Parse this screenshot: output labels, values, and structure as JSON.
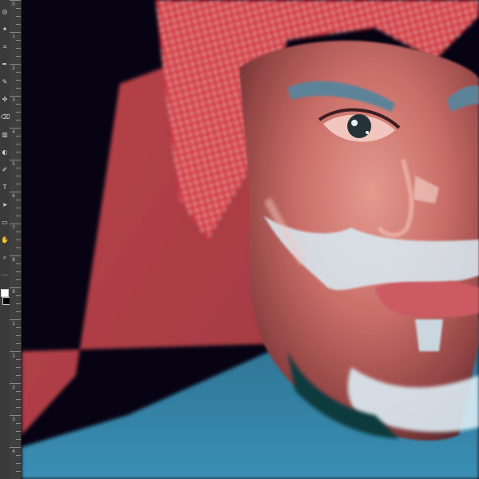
{
  "app": {
    "toolbar_tools": [
      {
        "name": "lasso-tool-icon",
        "glyph": "◎"
      },
      {
        "name": "quick-select-icon",
        "glyph": "✦"
      },
      {
        "name": "crop-tool-icon",
        "glyph": "⌗"
      },
      {
        "name": "eyedropper-icon",
        "glyph": "✒"
      },
      {
        "name": "brush-tool-icon",
        "glyph": "✎"
      },
      {
        "name": "clone-stamp-icon",
        "glyph": "✜"
      },
      {
        "name": "eraser-tool-icon",
        "glyph": "⌫"
      },
      {
        "name": "gradient-tool-icon",
        "glyph": "▥"
      },
      {
        "name": "dodge-tool-icon",
        "glyph": "◐"
      },
      {
        "name": "pen-tool-icon",
        "glyph": "✐"
      },
      {
        "name": "type-tool-icon",
        "glyph": "T"
      },
      {
        "name": "path-selection-icon",
        "glyph": "➤"
      },
      {
        "name": "rectangle-tool-icon",
        "glyph": "▭"
      },
      {
        "name": "hand-tool-icon",
        "glyph": "✋"
      },
      {
        "name": "zoom-tool-icon",
        "glyph": "⌕"
      },
      {
        "name": "edit-toolbar-icon",
        "glyph": "⋯"
      }
    ],
    "ruler_labels": [
      "0",
      "1",
      "2",
      "3",
      "4",
      "5",
      "6",
      "7",
      "8",
      "9",
      "1",
      "1",
      "2",
      "3",
      "4"
    ],
    "colors": {
      "foreground": "#ffffff",
      "background": "#000000"
    }
  },
  "artwork": {
    "subject": "digital painting of man in red-white checkered keffiyeh",
    "palette": {
      "background_dark": "#070313",
      "keffiyeh_red": "#b43f48",
      "keffiyeh_pattern": "#d7333f",
      "skin_light": "#d9837a",
      "skin_dark": "#8a3a3b",
      "beard": "#d8ecf4",
      "thobe_blue": "#2f6f8d"
    }
  }
}
